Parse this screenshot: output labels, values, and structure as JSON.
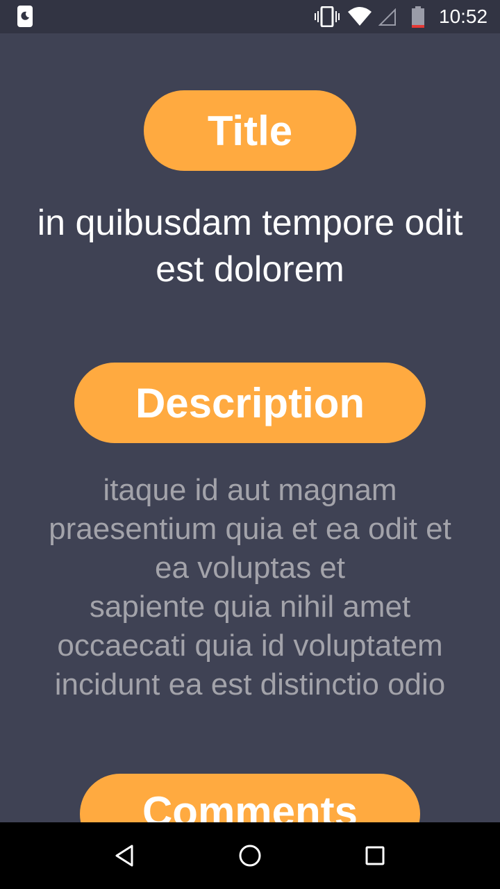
{
  "status_bar": {
    "time": "10:52",
    "icons": [
      "notification-icon",
      "vibrate-icon",
      "wifi-icon",
      "signal-icon",
      "battery-icon"
    ]
  },
  "sections": {
    "title_label": "Title",
    "title_text": "in quibusdam tempore odit est dolorem",
    "description_label": "Description",
    "description_lines": [
      "itaque id aut magnam",
      "praesentium quia et ea odit et",
      "ea voluptas et",
      "sapiente quia nihil amet",
      "occaecati quia id voluptatem",
      "incidunt ea est distinctio odio"
    ],
    "comments_label": "Comments"
  },
  "nav_bar": {
    "icons": [
      "back-icon",
      "home-icon",
      "recents-icon"
    ]
  },
  "colors": {
    "background": "#3f4254",
    "status_bar": "#323443",
    "pill": "#ffaa40",
    "description_text": "#a3a3aa"
  }
}
